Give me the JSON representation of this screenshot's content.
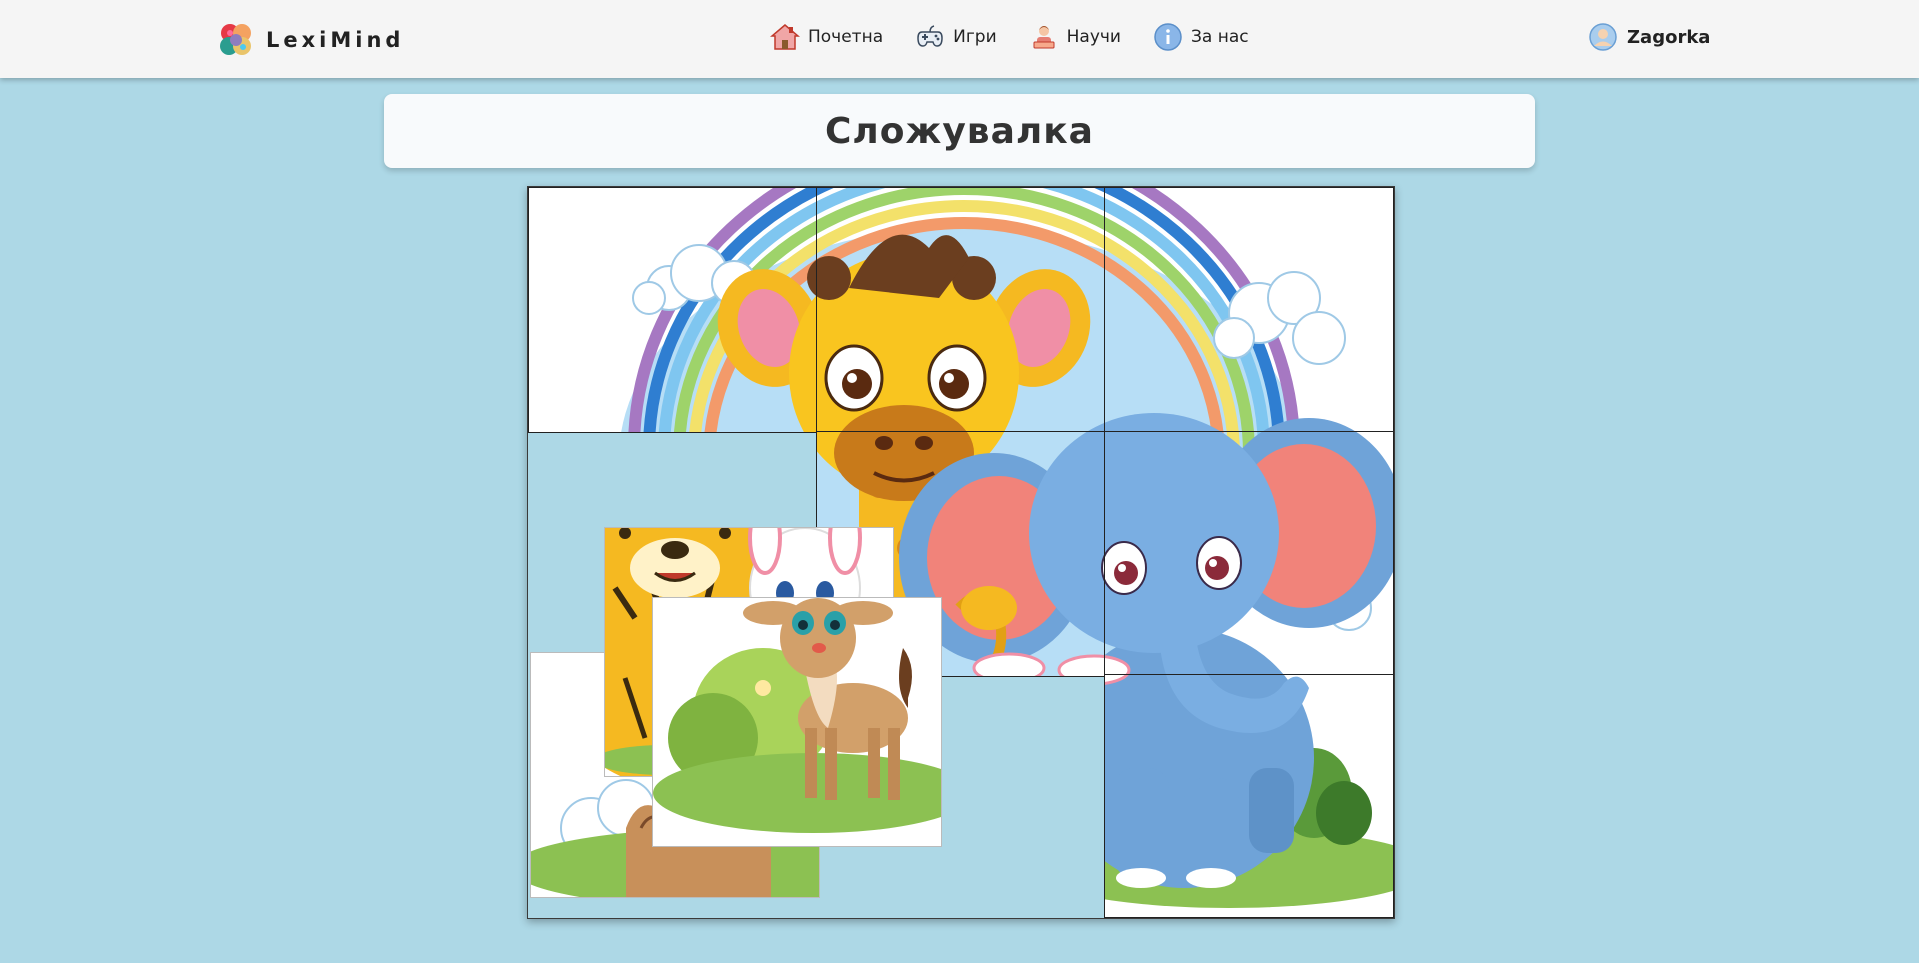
{
  "brand": {
    "name": "LexiMind",
    "icon": "brain-puzzle-icon"
  },
  "nav": {
    "items": [
      {
        "label": "Почетна",
        "icon": "home-icon"
      },
      {
        "label": "Игри",
        "icon": "gamepad-icon"
      },
      {
        "label": "Научи",
        "icon": "student-icon"
      },
      {
        "label": "За нас",
        "icon": "info-icon"
      }
    ],
    "user": {
      "name": "Zagorka",
      "icon": "user-avatar-icon"
    }
  },
  "page": {
    "title": "Сложувалка"
  },
  "puzzle": {
    "grid": {
      "rows": 3,
      "cols": 3
    },
    "placed_pieces": 6,
    "loose_pieces": 3,
    "image_subject": "giraffe-elephant-rainbow",
    "colors": {
      "board_bg": "#add8e6",
      "navbar_bg": "#f5f5f5",
      "title_bg": "#f8fafc"
    }
  }
}
